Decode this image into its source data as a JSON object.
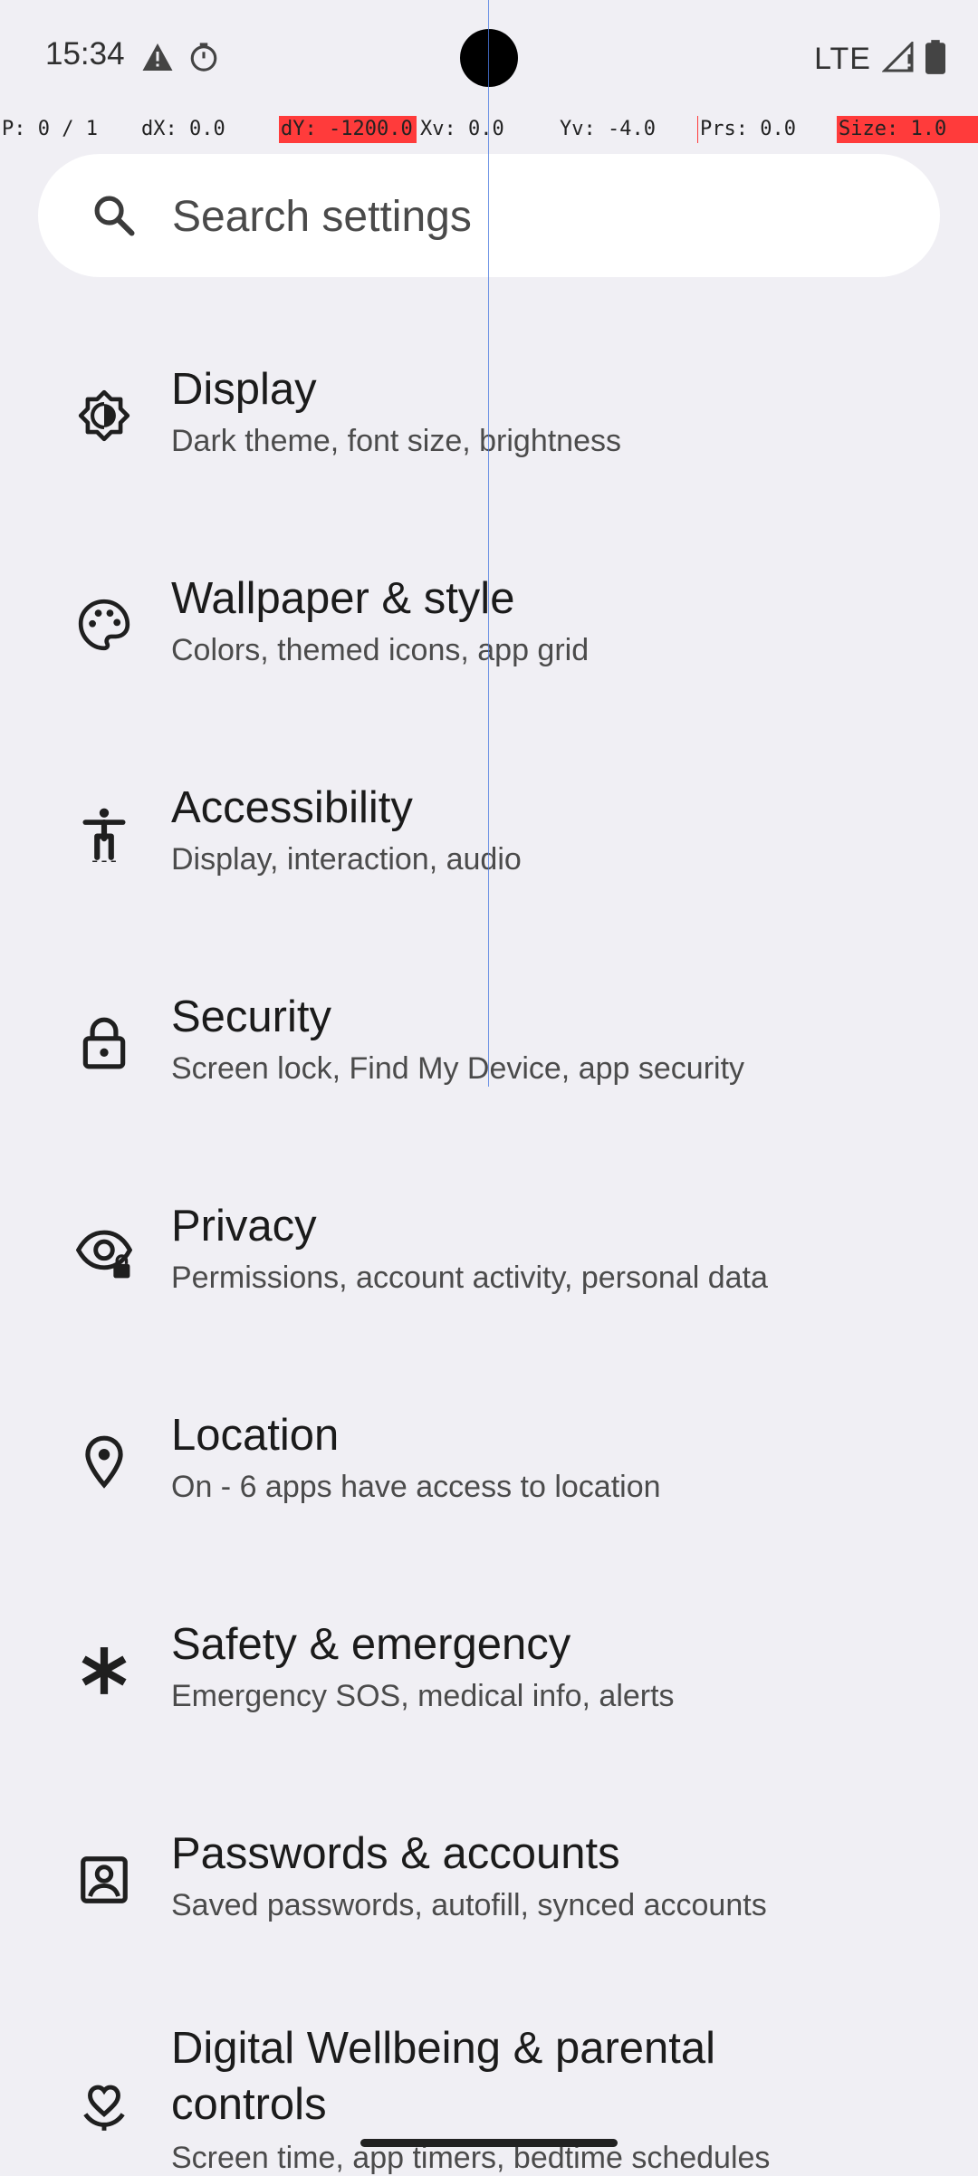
{
  "status_bar": {
    "time": "15:34",
    "network": "LTE",
    "icons": [
      "warning-icon",
      "timer-icon",
      "signal-icon",
      "battery-icon"
    ]
  },
  "debug_overlay": {
    "pointer": "P: 0 / 1",
    "dx": "dX: 0.0",
    "dy": "dY: -1200.0",
    "xv": "Xv: 0.0",
    "yv": "Yv: -4.0",
    "prs": "Prs: 0.0",
    "size": "Size: 1.0"
  },
  "search": {
    "placeholder": "Search settings"
  },
  "items": [
    {
      "title": "Display",
      "subtitle": "Dark theme, font size, brightness",
      "icon": "brightness-icon"
    },
    {
      "title": "Wallpaper & style",
      "subtitle": "Colors, themed icons, app grid",
      "icon": "palette-icon"
    },
    {
      "title": "Accessibility",
      "subtitle": "Display, interaction, audio",
      "icon": "accessibility-icon"
    },
    {
      "title": "Security",
      "subtitle": "Screen lock, Find My Device, app security",
      "icon": "lock-icon"
    },
    {
      "title": "Privacy",
      "subtitle": "Permissions, account activity, personal data",
      "icon": "privacy-eye-icon"
    },
    {
      "title": "Location",
      "subtitle": "On - 6 apps have access to location",
      "icon": "location-pin-icon"
    },
    {
      "title": "Safety & emergency",
      "subtitle": "Emergency SOS, medical info, alerts",
      "icon": "asterisk-icon"
    },
    {
      "title": "Passwords & accounts",
      "subtitle": "Saved passwords, autofill, synced accounts",
      "icon": "account-box-icon"
    },
    {
      "title": "Digital Wellbeing & parental controls",
      "title_line1": "Digital Wellbeing & parental",
      "title_line2": "controls",
      "subtitle": "Screen time, app timers, bedtime schedules",
      "icon": "wellbeing-icon"
    }
  ],
  "colors": {
    "background": "#f0eff4",
    "search_bg": "#ffffff",
    "debug_red": "#ff3b3b",
    "debug_line": "#4c7ae0"
  }
}
